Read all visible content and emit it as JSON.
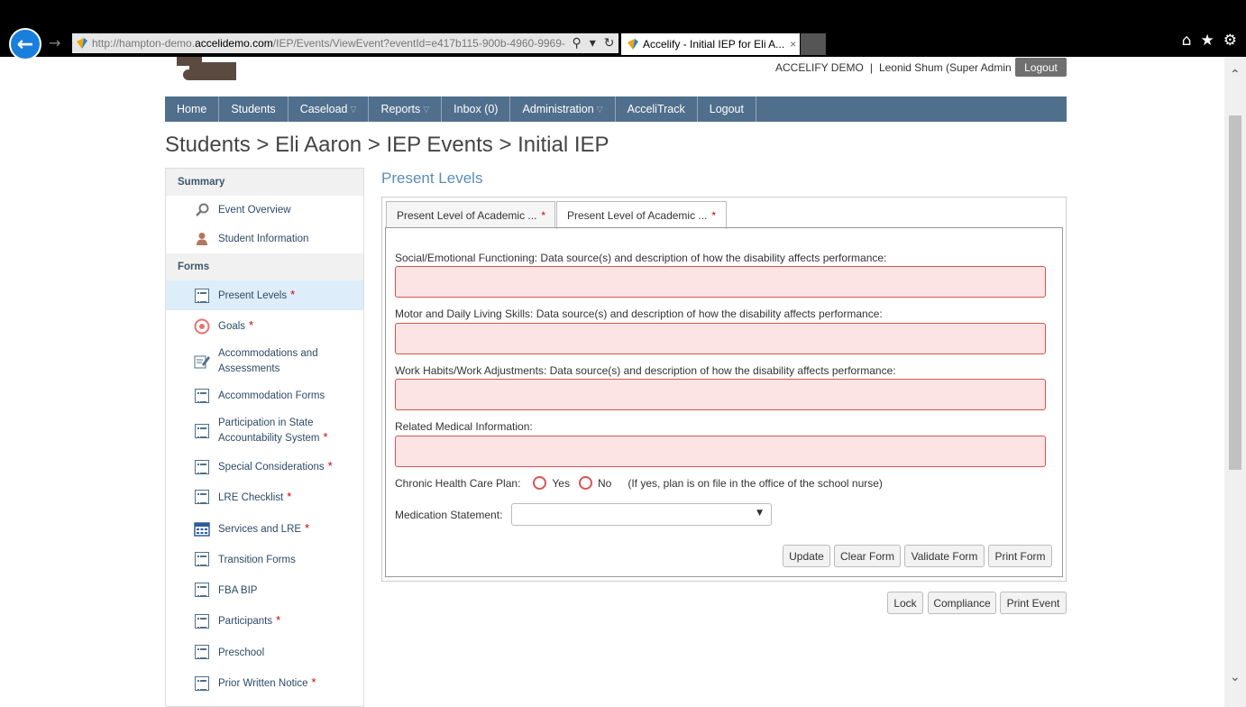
{
  "browser": {
    "url_prefix": "http://hampton-demo.",
    "url_domain": "accelidemo.com",
    "url_path": "/IEP/Events/ViewEvent?eventId=e417b115-900b-4960-9969-",
    "tab_title": "Accelify - Initial IEP for Eli A...",
    "tab_close": "×"
  },
  "header": {
    "org": "ACCELIFY DEMO",
    "separator": "|",
    "user": "Leonid Shum (Super Admin Plus)",
    "logout": "Logout"
  },
  "nav": [
    {
      "label": "Home",
      "dropdown": false
    },
    {
      "label": "Students",
      "dropdown": false
    },
    {
      "label": "Caseload",
      "dropdown": true
    },
    {
      "label": "Reports",
      "dropdown": true
    },
    {
      "label": "Inbox (0)",
      "dropdown": false
    },
    {
      "label": "Administration",
      "dropdown": true
    },
    {
      "label": "AcceliTrack",
      "dropdown": false
    },
    {
      "label": "Logout",
      "dropdown": false
    }
  ],
  "page_title": "Students > Eli Aaron > IEP Events > Initial IEP",
  "sidebar": {
    "summary_heading": "Summary",
    "summary_items": [
      {
        "label": "Event Overview",
        "icon": "search-icon"
      },
      {
        "label": "Student Information",
        "icon": "person-icon"
      }
    ],
    "forms_heading": "Forms",
    "forms_items": [
      {
        "label": "Present Levels",
        "required": "*",
        "icon": "list-icon"
      },
      {
        "label": "Goals",
        "required": "*",
        "icon": "target-icon"
      },
      {
        "label": "Accommodations and Assessments",
        "required": "",
        "icon": "edit-icon"
      },
      {
        "label": "Accommodation Forms",
        "required": "",
        "icon": "list-icon"
      },
      {
        "label": "Participation in State Accountability System",
        "required": "*",
        "icon": "list-icon"
      },
      {
        "label": "Special Considerations",
        "required": "*",
        "icon": "list-icon"
      },
      {
        "label": "LRE Checklist",
        "required": "*",
        "icon": "list-icon"
      },
      {
        "label": "Services and LRE",
        "required": "*",
        "icon": "calendar-icon"
      },
      {
        "label": "Transition Forms",
        "required": "",
        "icon": "list-icon"
      },
      {
        "label": "FBA BIP",
        "required": "",
        "icon": "list-icon"
      },
      {
        "label": "Participants",
        "required": "*",
        "icon": "list-icon"
      },
      {
        "label": "Preschool",
        "required": "",
        "icon": "list-icon"
      },
      {
        "label": "Prior Written Notice",
        "required": "*",
        "icon": "list-icon"
      }
    ]
  },
  "main": {
    "section_title": "Present Levels",
    "tabs": [
      {
        "label": "Present Level of Academic ...",
        "required": "*"
      },
      {
        "label": "Present Level of Academic ...",
        "required": "*"
      }
    ],
    "fields": [
      {
        "label": "Social/Emotional Functioning: Data source(s) and description of how the disability affects performance:",
        "value": ""
      },
      {
        "label": "Motor and Daily Living Skills: Data source(s) and description of how the disability affects performance:",
        "value": ""
      },
      {
        "label": "Work Habits/Work Adjustments: Data source(s) and description of how the disability affects performance:",
        "value": ""
      },
      {
        "label": "Related Medical Information:",
        "value": ""
      }
    ],
    "chronic_health": {
      "label": "Chronic Health Care Plan:",
      "yes": "Yes",
      "no": "No",
      "note": "(If yes, plan is on file in the office of the school nurse)"
    },
    "medication": {
      "label": "Medication Statement:",
      "value": ""
    },
    "form_buttons": [
      "Update",
      "Clear Form",
      "Validate Form",
      "Print Form"
    ],
    "event_buttons": [
      "Lock",
      "Compliance",
      "Print Event"
    ]
  },
  "colors": {
    "nav_bg": "#4f6f8c",
    "required": "#cc0000",
    "error_border": "#d9534f",
    "error_bg": "#fde4e4"
  }
}
